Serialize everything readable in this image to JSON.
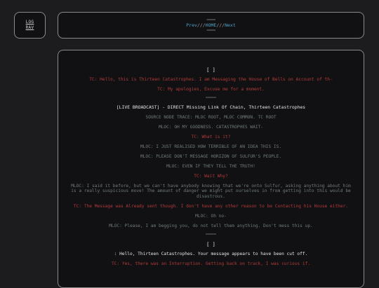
{
  "sidebar": {
    "log_label_line1": "LOG",
    "log_label_line2": "RAV"
  },
  "nav": {
    "separator": "=====",
    "prev": "Prev",
    "sep1": "///",
    "home": "HOME",
    "sep2": "///",
    "next": "Next"
  },
  "log": {
    "bracket1": "[ ]",
    "line1": "TC: Hello, this is Thirteen Catastrophes. I am Messaging the House of Bells on Account of th-",
    "line2": "TC: My apologies, Excuse me for a moment.",
    "divider": "=====",
    "broadcast_title": "[LIVE BROADCAST] - DIRECT Missing Link Of Chain, Thirteen Catastrophes",
    "trace": "SOURCE NODE TRACE: MLOC ROOT, MLOC COMMON. TC ROOT",
    "m1": "MLOC: OH MY GOODNESS. CATASTROPHES WAIT-",
    "t1": "TC: What is it?",
    "m2": "MLOC: I JUST REALISED HOW TERRIBLE OF AN IDEA THIS IS.",
    "m3": "MLOC: PLEASE DON'T MESSAGE HORIZON OF SULFUR'S PEOPLE.",
    "m4": "MLOC: EVEN IF THEY TELL THE TRUTH!",
    "t2": "TC: Wait Why?",
    "m5": "MLOC: I said it before, but we can't have anybody knowing that we're onto Sulfur, asking anything about him is a really suspicious move! The amount of danger we might put ourselves in from getting into this would be disastrous.",
    "t3": "TC: The Message was Already sent though. I don't have any other reason to be Contacting his House either.",
    "m6": "MLOC: Oh no-",
    "m7": "MLOC: Please, I am begging you, do not tell them anything. Don't mess this up.",
    "divider2": "=====",
    "bracket2": "[ ]",
    "r1": ": Hello, Thirteen Catastrophes. Your message appears to have been cut off.",
    "t4": "TC: Yes, there was an Interruption. Getting back on track, I was curious if."
  },
  "colors": {
    "tc": "#b33a3a",
    "mloc": "#6f7d76",
    "link": "#4fa3c7"
  }
}
